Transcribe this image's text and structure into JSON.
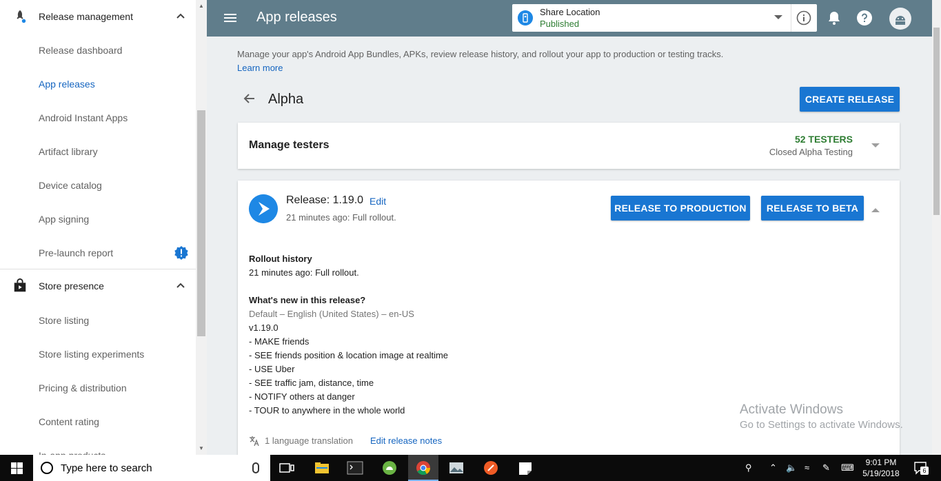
{
  "sidebar": {
    "release_section": "Release management",
    "release_items": [
      {
        "label": "Release dashboard"
      },
      {
        "label": "App releases"
      },
      {
        "label": "Android Instant Apps"
      },
      {
        "label": "Artifact library"
      },
      {
        "label": "Device catalog"
      },
      {
        "label": "App signing"
      },
      {
        "label": "Pre-launch report"
      }
    ],
    "store_section": "Store presence",
    "store_items": [
      {
        "label": "Store listing"
      },
      {
        "label": "Store listing experiments"
      },
      {
        "label": "Pricing & distribution"
      },
      {
        "label": "Content rating"
      },
      {
        "label": "In-app products"
      }
    ]
  },
  "topbar": {
    "title": "App releases",
    "app_name": "Share Location",
    "app_status": "Published"
  },
  "page": {
    "description": "Manage your app's Android App Bundles, APKs, review release history, and rollout your app to production or testing tracks.",
    "learn_more": "Learn more",
    "track_name": "Alpha",
    "create_release": "CREATE RELEASE"
  },
  "testers": {
    "title": "Manage testers",
    "count": "52 TESTERS",
    "subtitle": "Closed Alpha Testing"
  },
  "release": {
    "version": "Release: 1.19.0",
    "edit": "Edit",
    "time": "21 minutes ago: Full rollout.",
    "to_production": "RELEASE TO PRODUCTION",
    "to_beta": "RELEASE TO BETA",
    "rollout_history_title": "Rollout history",
    "rollout_history": "21 minutes ago: Full rollout.",
    "whats_new_title": "What's new in this release?",
    "locale": "Default – English (United States) – en-US",
    "notes": [
      "v1.19.0",
      "- MAKE friends",
      "- SEE friends position & location image at realtime",
      "- USE Uber",
      "- SEE traffic jam, distance, time",
      "- NOTIFY others at danger",
      "- TOUR to anywhere in the whole world"
    ],
    "translation": "1 language translation",
    "edit_notes": "Edit release notes"
  },
  "watermark": {
    "line1": "Activate Windows",
    "line2": "Go to Settings to activate Windows."
  },
  "taskbar": {
    "search_placeholder": "Type here to search",
    "time": "9:01 PM",
    "date": "5/19/2018",
    "notification_count": "6"
  },
  "colors": {
    "topbar": "#607d8b",
    "accent": "#1976d2",
    "link": "#1565c0",
    "published": "#2e7d32"
  }
}
